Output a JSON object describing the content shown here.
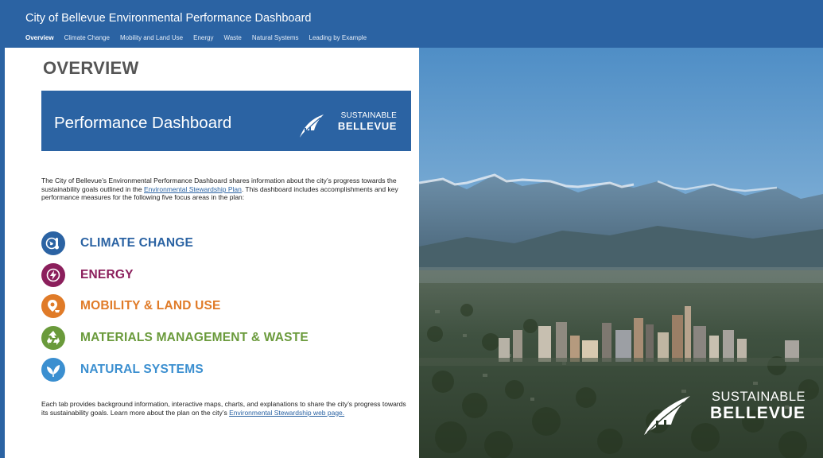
{
  "header": {
    "title": "City of Bellevue Environmental Performance Dashboard",
    "tabs": [
      "Overview",
      "Climate Change",
      "Mobility and Land Use",
      "Energy",
      "Waste",
      "Natural Systems",
      "Leading by Example"
    ],
    "active_tab": "Overview"
  },
  "main": {
    "heading": "OVERVIEW",
    "banner": {
      "title": "Performance Dashboard",
      "logo_top": "SUSTAINABLE",
      "logo_bottom": "BELLEVUE"
    },
    "intro": {
      "text_before_link": "The City of Bellevue’s Environmental Performance Dashboard shares information about the city’s progress towards the sustainability goals outlined in the ",
      "link": "Environmental Stewardship Plan",
      "text_after_link": ". This dashboard includes accomplishments and key performance measures for the following five focus areas in the plan:"
    },
    "focus_areas": [
      {
        "label": "CLIMATE CHANGE",
        "color": "#2b63a3",
        "icon": "globe-thermometer-icon"
      },
      {
        "label": "ENERGY",
        "color": "#8b1f5c",
        "icon": "lightning-icon"
      },
      {
        "label": "MOBILITY & LAND USE",
        "color": "#e07b28",
        "icon": "map-pin-icon"
      },
      {
        "label": "MATERIALS MANAGEMENT & WASTE",
        "color": "#6a9a3b",
        "icon": "recycle-icon"
      },
      {
        "label": "NATURAL SYSTEMS",
        "color": "#3b8fd0",
        "icon": "leaf-icon"
      }
    ],
    "outro": {
      "text": "Each tab provides background information, interactive maps, charts, and explanations to share the city’s progress towards its sustainability goals. Learn more about the plan on the city’s ",
      "link": "Environmental Stewardship web page."
    }
  },
  "photo": {
    "logo_top": "SUSTAINABLE",
    "logo_bottom": "BELLEVUE"
  }
}
